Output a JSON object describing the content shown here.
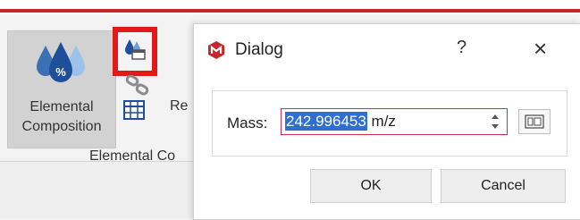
{
  "ribbon": {
    "elemental_line1": "Elemental",
    "elemental_line2": "Composition",
    "re_label": "Re",
    "group_label": "Elemental Co"
  },
  "dialog": {
    "title": "Dialog",
    "help": "?",
    "close": "×",
    "mass_label": "Mass:",
    "mass_value": "242.996453",
    "mass_unit": " m/z",
    "ok_label": "OK",
    "cancel_label": "Cancel"
  },
  "colors": {
    "accent_red": "#c8262d",
    "highlight_red": "#e3181b",
    "selection_blue": "#2f6fd1"
  },
  "icons": {
    "elemental": "drops-percent-icon",
    "highlighted": "drops-window-icon",
    "link": "link-icon",
    "table": "table-icon",
    "app": "app-logo-icon",
    "calc": "calculator-icon"
  }
}
